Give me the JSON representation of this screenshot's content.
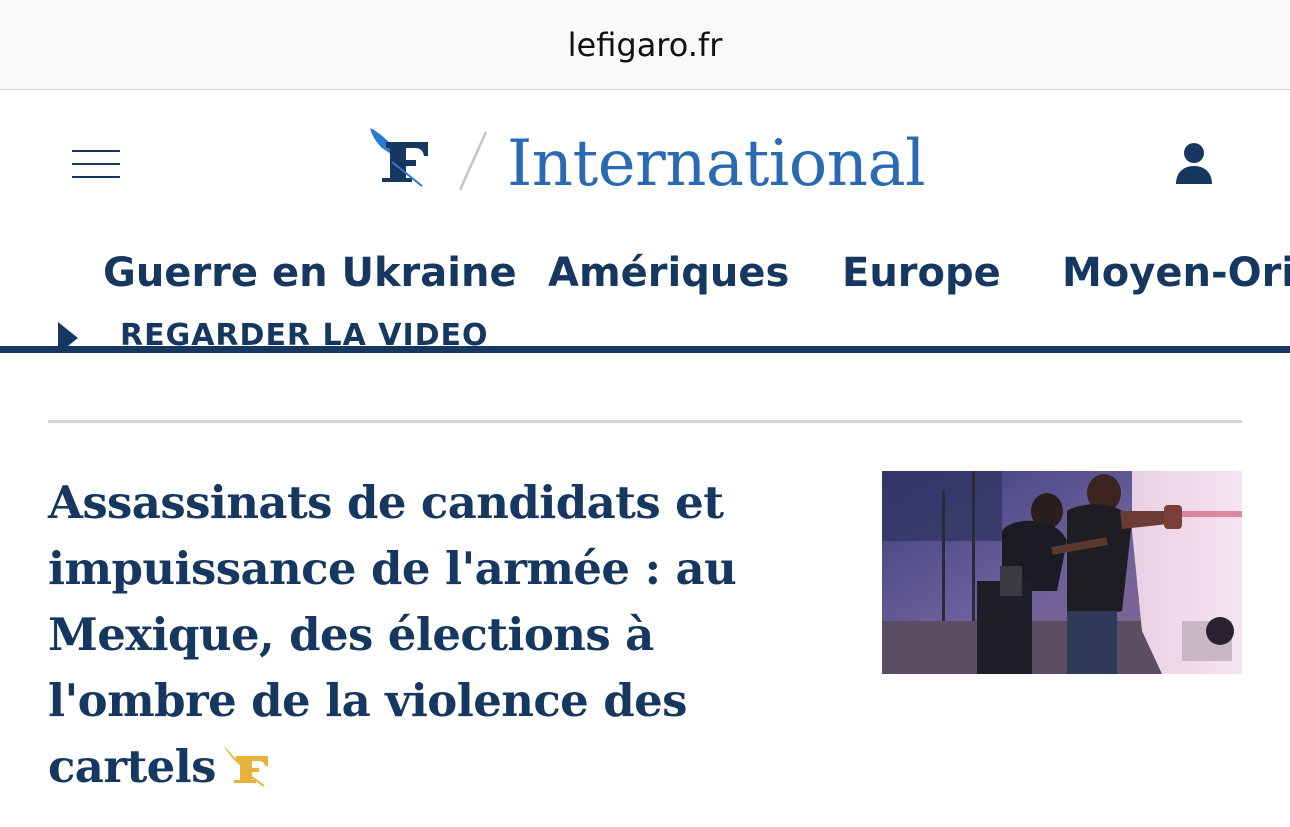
{
  "browser": {
    "url": "lefigaro.fr"
  },
  "header": {
    "section_title": "International",
    "icons": {
      "menu": "hamburger-menu-icon",
      "logo": "le-figaro-f-logo",
      "user": "user-account-icon"
    }
  },
  "nav": {
    "items": [
      {
        "label": "Guerre en Ukraine"
      },
      {
        "label": "Amériques"
      },
      {
        "label": "Europe"
      },
      {
        "label": "Moyen-Orient"
      }
    ]
  },
  "video_link": {
    "label": "REGARDER LA VIDÉO"
  },
  "article": {
    "headline": "Assassinats de candidats et impuissance de l'armée : au Mexique, des élections à l'ombre de la violence des cartels",
    "premium_icon": "premium-f-icon",
    "thumbnail_alt": "Police officers frisking a man against a vehicle at night"
  },
  "colors": {
    "brand_navy": "#163860",
    "section_blue": "#2a6ab2",
    "logo_blue": "#2a78d0",
    "premium_gold": "#e8b23a",
    "divider": "#d4d4d4"
  }
}
